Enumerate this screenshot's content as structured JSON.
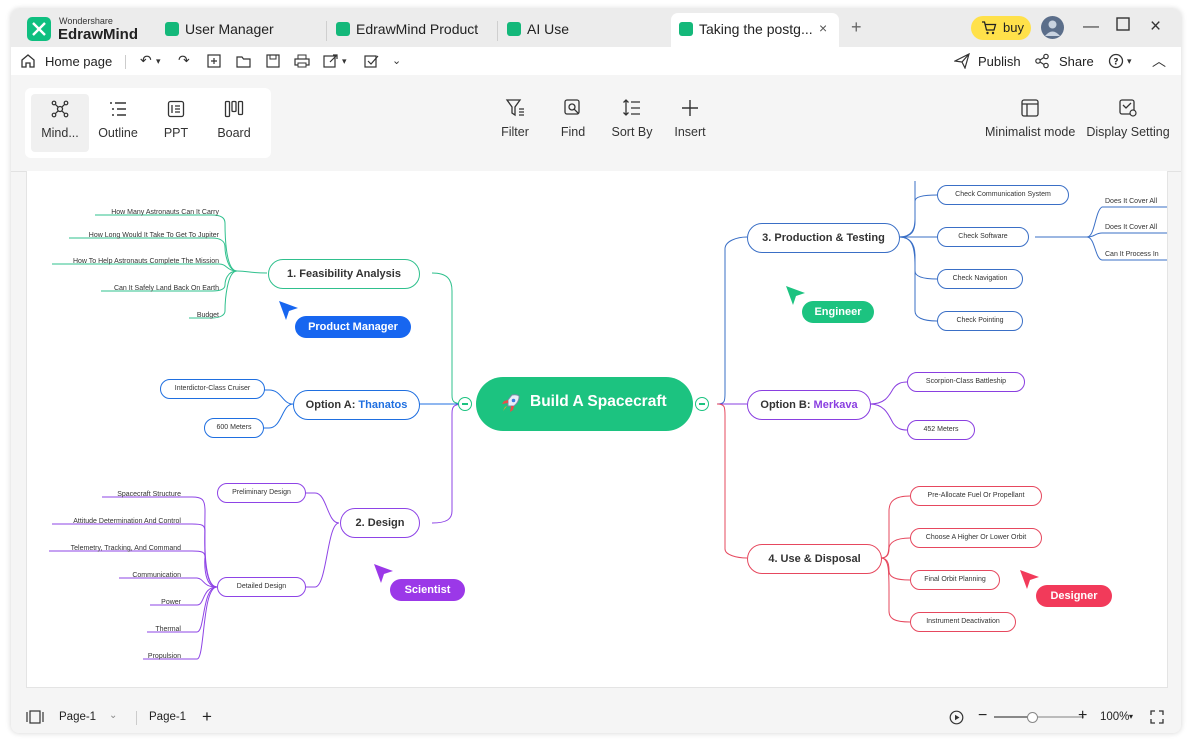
{
  "app": {
    "brand_small": "Wondershare",
    "brand_big": "EdrawMind"
  },
  "tabs": [
    {
      "label": "User Manager"
    },
    {
      "label": "EdrawMind Product"
    },
    {
      "label": "AI Use"
    },
    {
      "label": "Taking the postg..."
    }
  ],
  "titlebar": {
    "buy_label": "buy",
    "new_tab": "+"
  },
  "quickbar": {
    "home_label": "Home page",
    "publish_label": "Publish",
    "share_label": "Share"
  },
  "views": [
    {
      "label": "Mind..."
    },
    {
      "label": "Outline"
    },
    {
      "label": "PPT"
    },
    {
      "label": "Board"
    }
  ],
  "tools": {
    "filter": "Filter",
    "find": "Find",
    "sort_by": "Sort By",
    "insert": "Insert",
    "minimalist": "Minimalist mode",
    "display_setting": "Display Setting"
  },
  "colors": {
    "root": "#1cc380",
    "feasibility": "#2fc08d",
    "option_a": "#1f6fe0",
    "design": "#8e44e6",
    "production": "#3a6fc6",
    "option_b": "#8a3fe0",
    "use_disposal": "#e6485e"
  },
  "mindmap": {
    "root": "Build A Spacecraft",
    "feasibility": {
      "title": "1. Feasibility Analysis",
      "items": [
        "How Many Astronauts Can It Carry",
        "How Long Would It Take To Get To Jupiter",
        "How To Help Astronauts Complete The Mission",
        "Can It Safely Land Back On Earth",
        "Budget"
      ]
    },
    "option_a": {
      "prefix": "Option A: ",
      "highlight": "Thanatos",
      "items": [
        "Interdictor-Class Cruiser",
        "600 Meters"
      ]
    },
    "design": {
      "title": "2. Design",
      "preliminary": "Preliminary Design",
      "detailed": "Detailed Design",
      "items": [
        "Spacecraft Structure",
        "Attitude Determination And Control",
        "Telemetry, Tracking, And Command",
        "Communication",
        "Power",
        "Thermal",
        "Propulsion"
      ]
    },
    "production": {
      "title": "3. Production & Testing",
      "items": [
        "Check Communication System",
        "Check Software",
        "Check Navigation",
        "Check Pointing"
      ],
      "software_items": [
        "Does It Cover All",
        "Does It Cover All",
        "Can It Process In"
      ]
    },
    "option_b": {
      "prefix": "Option B: ",
      "highlight": "Merkava",
      "items": [
        "Scorpion-Class Battleship",
        "452 Meters"
      ]
    },
    "use_disposal": {
      "title": "4. Use & Disposal",
      "items": [
        "Pre-Allocate Fuel Or Propellant",
        "Choose A Higher Or Lower Orbit",
        "Final Orbit Planning",
        "Instrument Deactivation"
      ]
    }
  },
  "cursors": [
    {
      "label": "Product Manager",
      "color": "#1766f0"
    },
    {
      "label": "Engineer",
      "color": "#1cc380"
    },
    {
      "label": "Scientist",
      "color": "#9b38e8"
    },
    {
      "label": "Designer",
      "color": "#f23a5a"
    }
  ],
  "statusbar": {
    "page_selector": "Page-1",
    "page_tab": "Page-1",
    "add": "+",
    "zoom": "100%"
  }
}
